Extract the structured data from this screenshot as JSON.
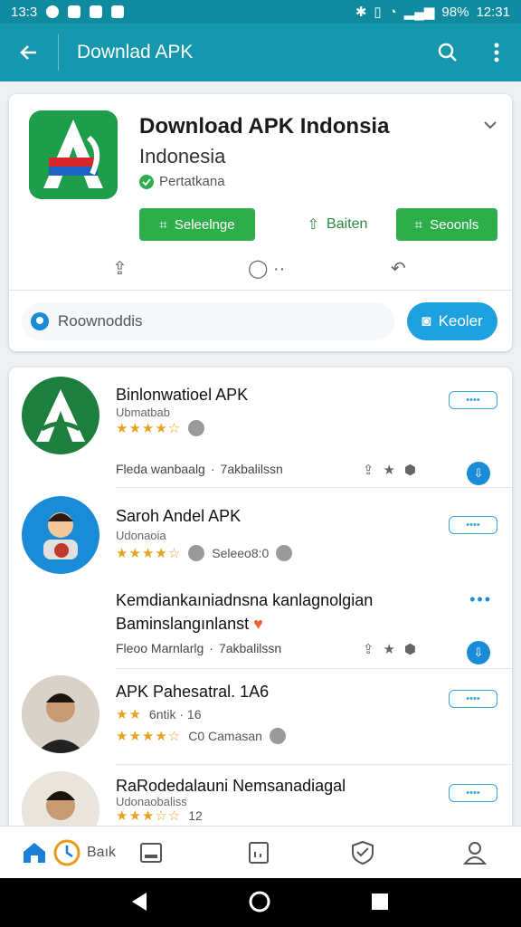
{
  "status_bar": {
    "time_left": "13:3",
    "battery": "98%",
    "time_right": "12:31"
  },
  "app_bar": {
    "title": "Downlad APK",
    "back_icon": "arrow-left-icon",
    "search_icon": "search-icon",
    "more_icon": "more-vert-icon"
  },
  "app_header": {
    "name": "Download APK Indonsia",
    "subtitle": "Indonesia",
    "verified_label": "Pertatkana",
    "buttons": {
      "primary": "Seleelnge",
      "middle": "Baiten",
      "secondary": "Seoonls"
    },
    "search": {
      "placeholder": "Roownoddis"
    },
    "search_button": "Keoler"
  },
  "items": [
    {
      "title": "Binlonwatioel APK",
      "subtitle": "Ubmatbab",
      "stars": "★★★★☆",
      "pill": "••••",
      "meta_left": "Fleda wanbaalg",
      "meta_right": "7akbalilssn"
    },
    {
      "title": "Saroh Andel APK",
      "subtitle": "Udonaoia",
      "stars": "★★★★☆",
      "rating_extra": "Seleeo8:0",
      "pill": "••••",
      "desc_line1": "Kemdiankaıniadnsna kanlagnolgian",
      "desc_line2": "Baminslangınlanst",
      "heart": "♥",
      "meta_left": "Fleoo Marnlarlg",
      "meta_right": "7akbalilssn"
    },
    {
      "title": "APK Pahesatral. 1A6",
      "subtitle_stars": "★★",
      "subtitle_text": "6ntik · 16",
      "stars": "★★★★☆",
      "rating_extra": "C0 Camasan",
      "pill": "••••"
    },
    {
      "title": "RaRodedalauni Nemsanadiagal",
      "subtitle": "Udonaobaliss",
      "stars": "★★★☆☆",
      "rating_extra": "12",
      "pill": "••••"
    }
  ],
  "bottom_nav": {
    "home_icon": "home-icon",
    "clock_label": "Baık",
    "tablet_icon": "tablet-icon",
    "bookmark_icon": "bookmark-icon",
    "shield_icon": "shield-icon",
    "profile_icon": "profile-icon"
  },
  "colors": {
    "appbar": "#1597ad",
    "statusbar": "#0f8a9e",
    "green": "#2eae4b",
    "blue": "#1ea1e0",
    "star": "#e8a21b"
  }
}
